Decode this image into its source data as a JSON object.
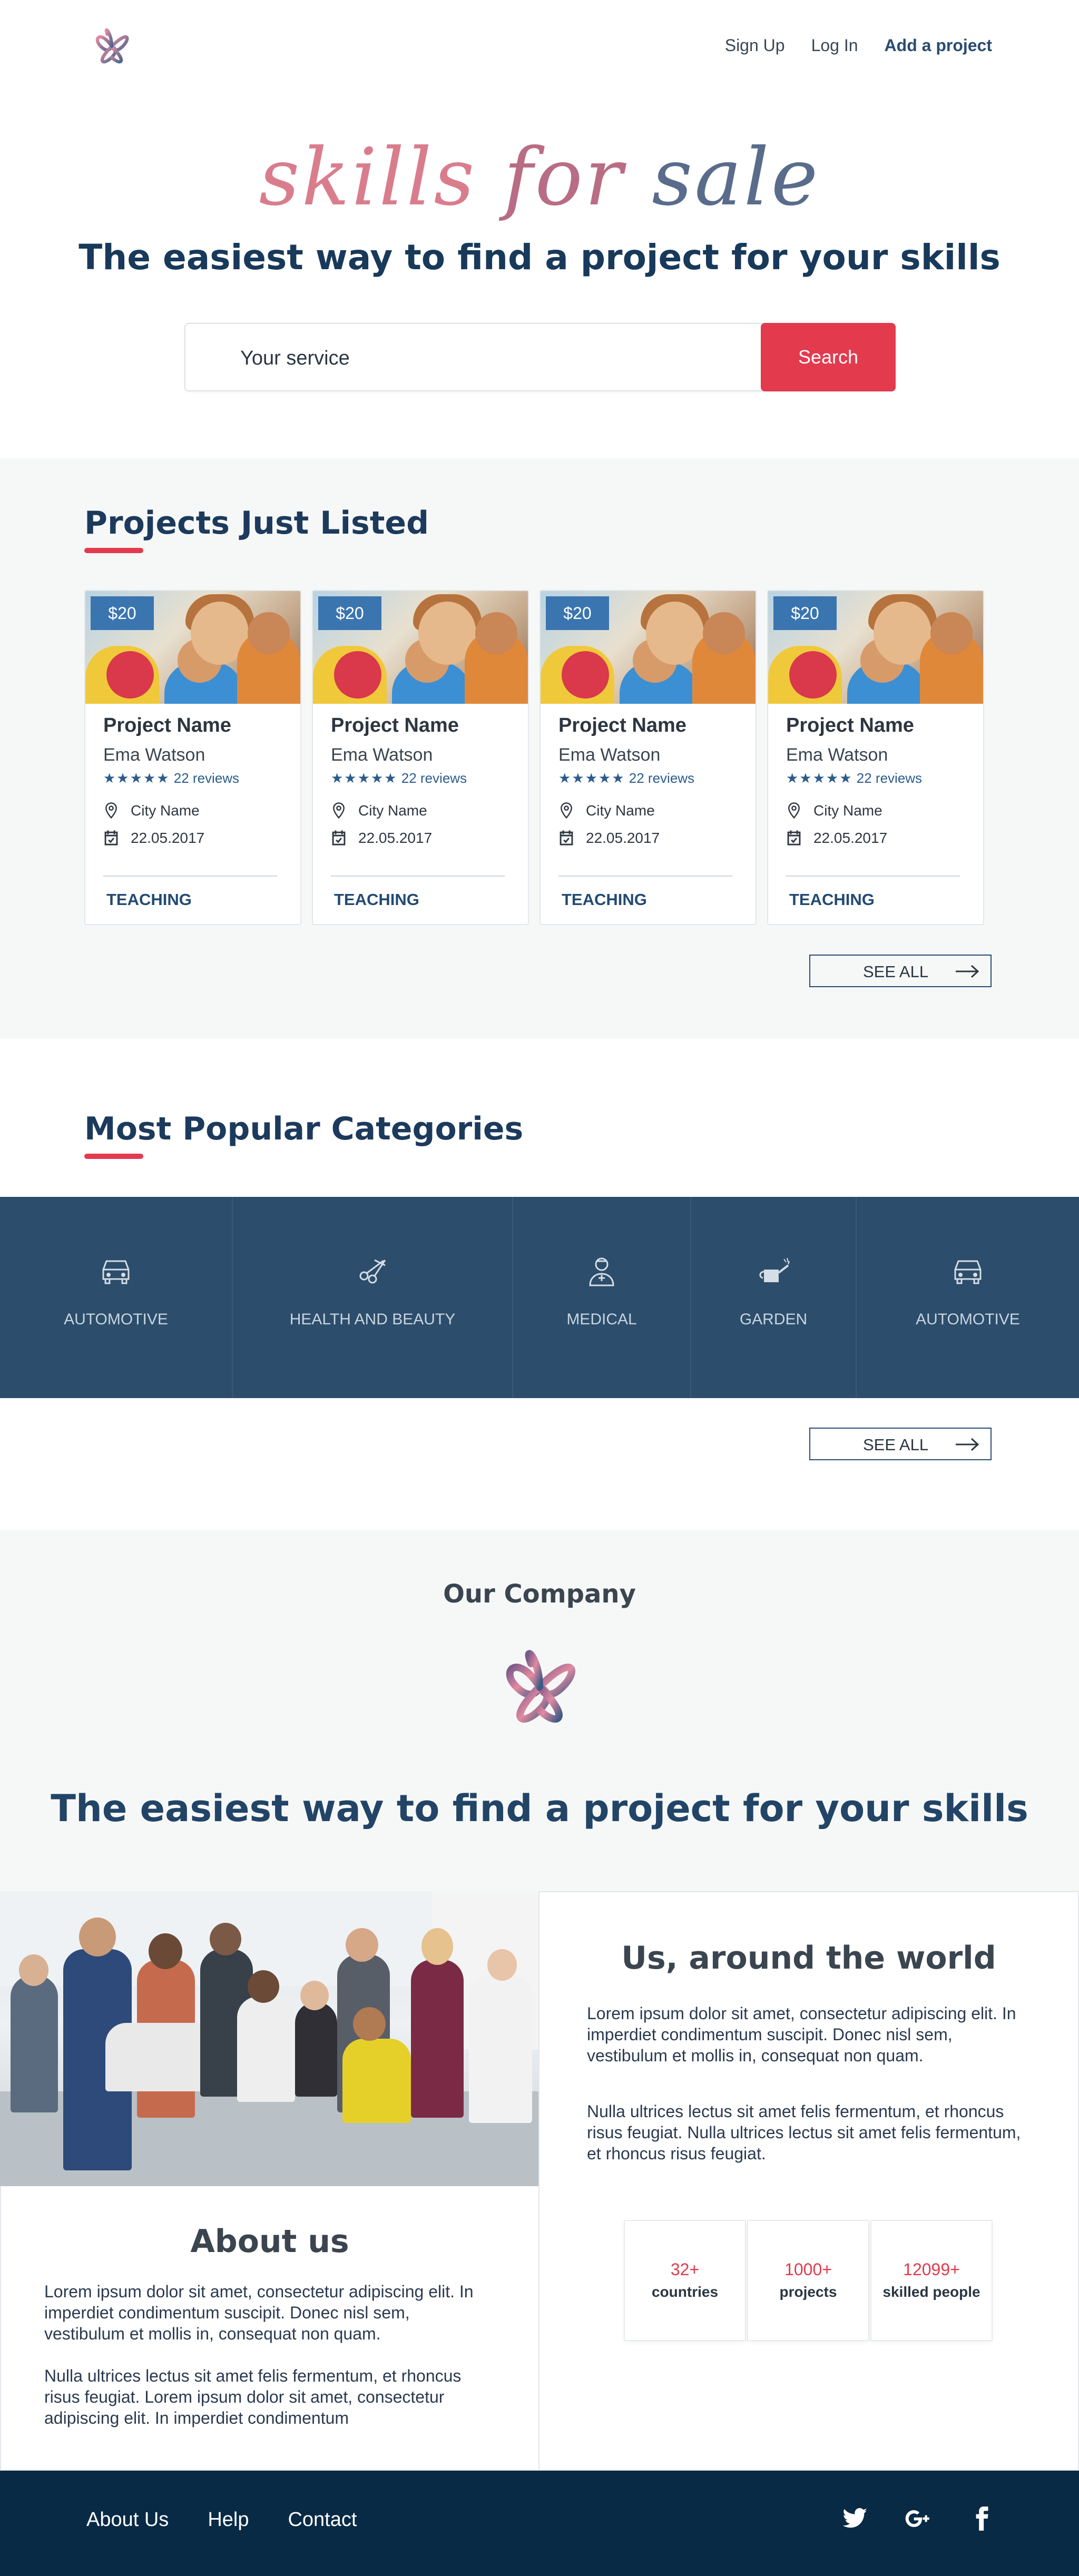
{
  "header": {
    "nav": [
      "Sign Up",
      "Log In",
      "Add a project"
    ]
  },
  "hero": {
    "script_logo": [
      "skills",
      "for",
      "sale"
    ],
    "title": "The easiest way to find a project for your skills",
    "search": {
      "placeholder": "Your service",
      "button": "Search"
    }
  },
  "projects": {
    "title": "Projects Just Listed",
    "cards": [
      {
        "price": "$20",
        "name": "Project Name",
        "author": "Ema Watson",
        "stars": "★★★★★",
        "reviews": "22 reviews",
        "city": "City Name",
        "date": "22.05.2017",
        "category": "TEACHING"
      },
      {
        "price": "$20",
        "name": "Project Name",
        "author": "Ema Watson",
        "stars": "★★★★★",
        "reviews": "22 reviews",
        "city": "City Name",
        "date": "22.05.2017",
        "category": "TEACHING"
      },
      {
        "price": "$20",
        "name": "Project Name",
        "author": "Ema Watson",
        "stars": "★★★★★",
        "reviews": "22 reviews",
        "city": "City Name",
        "date": "22.05.2017",
        "category": "TEACHING"
      },
      {
        "price": "$20",
        "name": "Project Name",
        "author": "Ema Watson",
        "stars": "★★★★★",
        "reviews": "22 reviews",
        "city": "City Name",
        "date": "22.05.2017",
        "category": "TEACHING"
      }
    ],
    "see_all": "SEE ALL"
  },
  "categories": {
    "title": "Most Popular Categories",
    "items": [
      {
        "label": "AUTOMOTIVE",
        "icon": "car-icon"
      },
      {
        "label": "HEALTH AND BEAUTY",
        "icon": "scissors-icon"
      },
      {
        "label": "MEDICAL",
        "icon": "doctor-icon"
      },
      {
        "label": "GARDEN",
        "icon": "watering-can-icon"
      },
      {
        "label": "AUTOMOTIVE",
        "icon": "car-icon"
      }
    ],
    "see_all": "SEE ALL"
  },
  "company": {
    "title": "Our Company",
    "tagline": "The easiest way to find a project for your skills"
  },
  "about": {
    "title": "About us",
    "p1": "Lorem ipsum dolor sit amet, consectetur adipiscing elit. In imperdiet condimentum suscipit. Donec nisl sem, vestibulum et mollis in, consequat non quam.",
    "p2": "Nulla ultrices lectus sit amet felis fermentum, et rhoncus risus feugiat. Lorem ipsum dolor sit amet, consectetur adipiscing elit. In imperdiet condimentum"
  },
  "world": {
    "title": "Us, around the world",
    "p1": "Lorem ipsum dolor sit amet, consectetur adipiscing elit. In imperdiet condimentum suscipit. Donec nisl sem, vestibulum et mollis in, consequat non quam.",
    "p2": "Nulla ultrices lectus sit amet felis fermentum, et rhoncus risus feugiat. Nulla ultrices lectus sit amet felis fermentum, et rhoncus risus feugiat.",
    "stats": [
      {
        "num": "32+",
        "caption": "countries"
      },
      {
        "num": "1000+",
        "caption": "projects"
      },
      {
        "num": "12099+",
        "caption": "skilled people"
      }
    ]
  },
  "footer": {
    "links": [
      "About Us",
      "Help",
      "Contact"
    ],
    "social": [
      "twitter-icon",
      "google-plus-icon",
      "facebook-icon"
    ]
  },
  "colors": {
    "accent": "#e33a4e",
    "navy": "#2c4d6b",
    "footer": "#082a45",
    "price_badge": "#3a75b0"
  }
}
